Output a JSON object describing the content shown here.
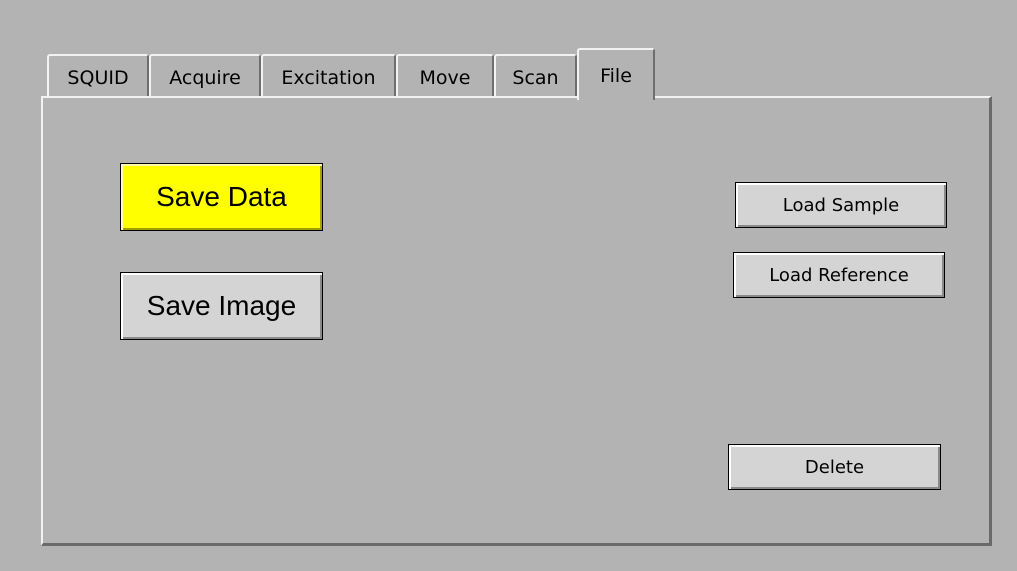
{
  "tabs": [
    {
      "label": "SQUID",
      "active": false
    },
    {
      "label": "Acquire",
      "active": false
    },
    {
      "label": "Excitation",
      "active": false
    },
    {
      "label": "Move",
      "active": false
    },
    {
      "label": "Scan",
      "active": false
    },
    {
      "label": "File",
      "active": true
    }
  ],
  "buttons": {
    "save_data": "Save Data",
    "save_image": "Save Image",
    "load_sample": "Load Sample",
    "load_reference": "Load Reference",
    "delete": "Delete"
  },
  "colors": {
    "background": "#b3b3b3",
    "save_data_highlight": "#ffff00",
    "button_face": "#d4d4d4"
  }
}
